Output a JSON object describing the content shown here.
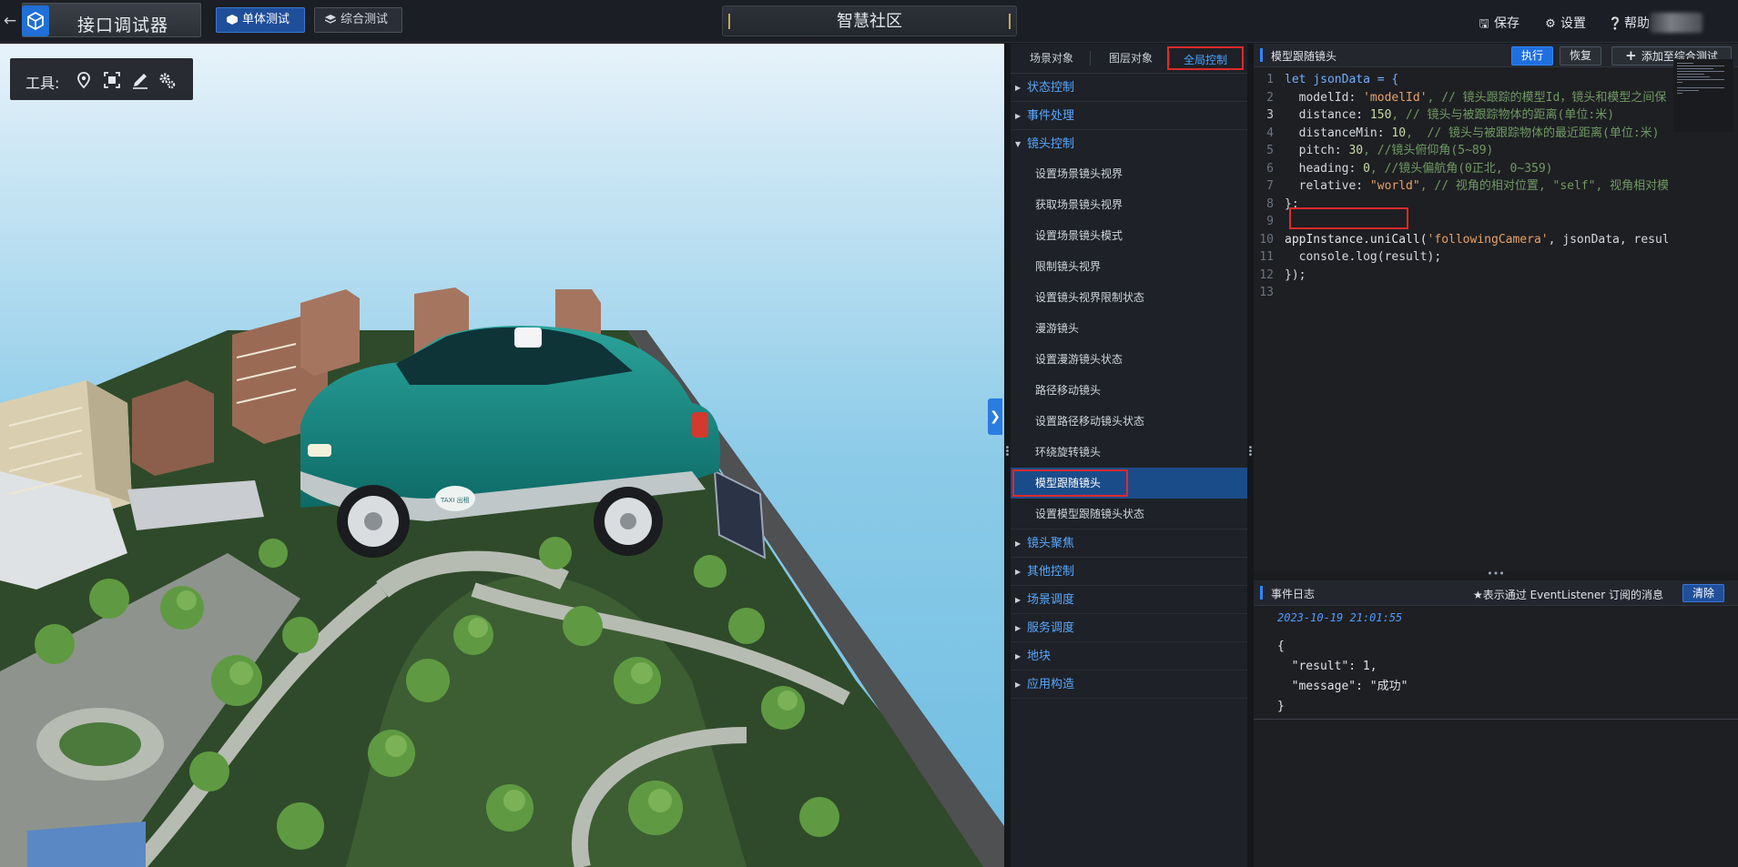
{
  "header": {
    "app_title": "接口调试器",
    "modes": [
      "单体测试",
      "综合测试"
    ],
    "scene_title": "智慧社区",
    "save": "保存",
    "settings": "设置",
    "help": "帮助"
  },
  "viewport": {
    "tools_label": "工具:",
    "tools": [
      "location-pin-icon",
      "scan-frame-icon",
      "pencil-icon",
      "settings-gears-icon"
    ],
    "car_sign": "TAXI 出租"
  },
  "nav": {
    "tabs": [
      "场景对象",
      "图层对象",
      "全局控制"
    ],
    "active_tab": "全局控制",
    "groups_top": [
      "状态控制",
      "事件处理",
      "镜头控制"
    ],
    "camera_items": [
      "设置场景镜头视界",
      "获取场景镜头视界",
      "设置场景镜头模式",
      "限制镜头视界",
      "设置镜头视界限制状态",
      "漫游镜头",
      "设置漫游镜头状态",
      "路径移动镜头",
      "设置路径移动镜头状态",
      "环绕旋转镜头",
      "模型跟随镜头",
      "设置模型跟随镜头状态"
    ],
    "active_item": "模型跟随镜头",
    "groups_bottom": [
      "镜头聚焦",
      "其他控制",
      "场景调度",
      "服务调度",
      "地块",
      "应用构造"
    ]
  },
  "editor": {
    "title": "模型跟随镜头",
    "run": "执行",
    "reset": "恢复",
    "add": "添加至综合测试",
    "line_numbers": [
      "1",
      "2",
      "3",
      "4",
      "5",
      "6",
      "7",
      "8",
      "9",
      "10",
      "11",
      "12",
      "13"
    ],
    "code": {
      "l1": "let jsonData = {",
      "l2_key": "  modelId: ",
      "l2_val": "'modelId'",
      "l2_com": ", // 镜头跟踪的模型Id，镜头和模型之间保",
      "l3_key": "  distance: ",
      "l3_val": "150",
      "l3_com": ", // 镜头与被跟踪物体的距离(单位:米)",
      "l4_key": "  distanceMin: ",
      "l4_val": "10",
      "l4_com": ",  // 镜头与被跟踪物体的最近距离(单位:米)",
      "l5_key": "  pitch: ",
      "l5_val": "30",
      "l5_com": ", //镜头俯仰角(5~89)",
      "l6_key": "  heading: ",
      "l6_val": "0",
      "l6_com": ", //镜头偏航角(0正北, 0~359)",
      "l7_key": "  relative: ",
      "l7_val": "\"world\"",
      "l7_com": ", // 视角的相对位置, \"self\", 视角相对模",
      "l8": "};",
      "l10_pre": "appInstance.uniCall(",
      "l10_str": "'followingCamera'",
      "l10_post": ", jsonData, result",
      "l11": "  console.log(result);",
      "l12": "});"
    }
  },
  "event_log": {
    "title": "事件日志",
    "hint": "★表示通过 EventListener 订阅的消息",
    "clear": "清除",
    "timestamp": "2023-10-19 21:01:55",
    "json": "{\n  \"result\": 1,\n  \"message\": \"成功\"\n}"
  }
}
